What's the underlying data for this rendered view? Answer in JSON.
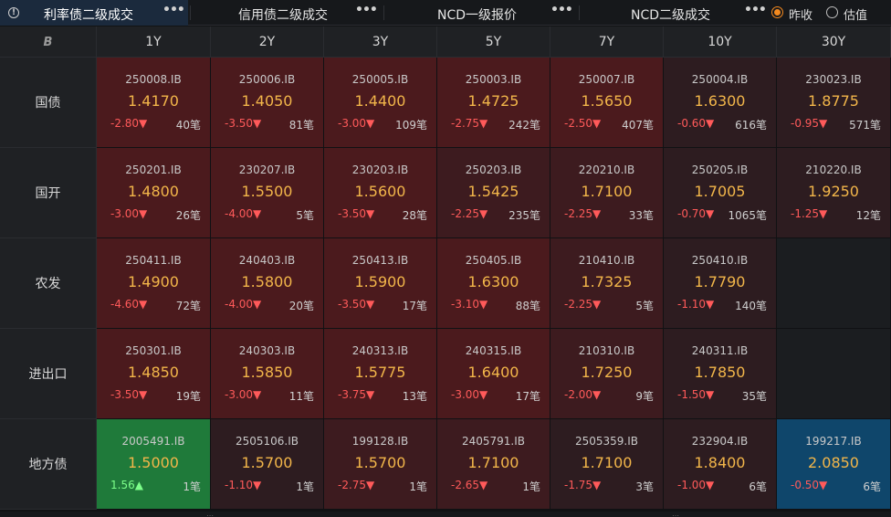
{
  "tabs": [
    {
      "label": "利率债二级成交",
      "active": true
    },
    {
      "label": "信用债二级成交",
      "active": false
    },
    {
      "label": "NCD一级报价",
      "active": false
    },
    {
      "label": "NCD二级成交",
      "active": false
    }
  ],
  "radios": [
    {
      "label": "昨收",
      "checked": true
    },
    {
      "label": "估值",
      "checked": false
    }
  ],
  "dots": "•••",
  "corner_icon": "B",
  "terms": [
    "1Y",
    "2Y",
    "3Y",
    "5Y",
    "7Y",
    "10Y",
    "30Y"
  ],
  "colors": {
    "bg_red_strong": "#4b1a1d",
    "bg_red_mid": "#3d1b1f",
    "bg_red_dim": "#2d1c20",
    "bg_green": "#1f7a3a",
    "bg_blue": "#0f466b",
    "price": "#f2b64a",
    "change_down": "#ff5a5a",
    "change_up": "#7dff8a"
  },
  "rows": [
    {
      "label": "国债",
      "cells": [
        {
          "code": "250008.IB",
          "price": "1.4170",
          "change": "-2.80▼",
          "count": "40笔",
          "tone": "red_strong"
        },
        {
          "code": "250006.IB",
          "price": "1.4050",
          "change": "-3.50▼",
          "count": "81笔",
          "tone": "red_strong"
        },
        {
          "code": "250005.IB",
          "price": "1.4400",
          "change": "-3.00▼",
          "count": "109笔",
          "tone": "red_strong"
        },
        {
          "code": "250003.IB",
          "price": "1.4725",
          "change": "-2.75▼",
          "count": "242笔",
          "tone": "red_strong"
        },
        {
          "code": "250007.IB",
          "price": "1.5650",
          "change": "-2.50▼",
          "count": "407笔",
          "tone": "red_strong"
        },
        {
          "code": "250004.IB",
          "price": "1.6300",
          "change": "-0.60▼",
          "count": "616笔",
          "tone": "red_dim"
        },
        {
          "code": "230023.IB",
          "price": "1.8775",
          "change": "-0.95▼",
          "count": "571笔",
          "tone": "red_dim"
        }
      ]
    },
    {
      "label": "国开",
      "cells": [
        {
          "code": "250201.IB",
          "price": "1.4800",
          "change": "-3.00▼",
          "count": "26笔",
          "tone": "red_strong"
        },
        {
          "code": "230207.IB",
          "price": "1.5500",
          "change": "-4.00▼",
          "count": "5笔",
          "tone": "red_strong"
        },
        {
          "code": "230203.IB",
          "price": "1.5600",
          "change": "-3.50▼",
          "count": "28笔",
          "tone": "red_strong"
        },
        {
          "code": "250203.IB",
          "price": "1.5425",
          "change": "-2.25▼",
          "count": "235笔",
          "tone": "red_mid"
        },
        {
          "code": "220210.IB",
          "price": "1.7100",
          "change": "-2.25▼",
          "count": "33笔",
          "tone": "red_mid"
        },
        {
          "code": "250205.IB",
          "price": "1.7005",
          "change": "-0.70▼",
          "count": "1065笔",
          "tone": "red_dim"
        },
        {
          "code": "210220.IB",
          "price": "1.9250",
          "change": "-1.25▼",
          "count": "12笔",
          "tone": "red_dim"
        }
      ]
    },
    {
      "label": "农发",
      "cells": [
        {
          "code": "250411.IB",
          "price": "1.4900",
          "change": "-4.60▼",
          "count": "72笔",
          "tone": "red_strong"
        },
        {
          "code": "240403.IB",
          "price": "1.5800",
          "change": "-4.00▼",
          "count": "20笔",
          "tone": "red_strong"
        },
        {
          "code": "250413.IB",
          "price": "1.5900",
          "change": "-3.50▼",
          "count": "17笔",
          "tone": "red_strong"
        },
        {
          "code": "250405.IB",
          "price": "1.6300",
          "change": "-3.10▼",
          "count": "88笔",
          "tone": "red_strong"
        },
        {
          "code": "210410.IB",
          "price": "1.7325",
          "change": "-2.25▼",
          "count": "5笔",
          "tone": "red_mid"
        },
        {
          "code": "250410.IB",
          "price": "1.7790",
          "change": "-1.10▼",
          "count": "140笔",
          "tone": "red_dim"
        },
        null
      ]
    },
    {
      "label": "进出口",
      "cells": [
        {
          "code": "250301.IB",
          "price": "1.4850",
          "change": "-3.50▼",
          "count": "19笔",
          "tone": "red_strong"
        },
        {
          "code": "240303.IB",
          "price": "1.5850",
          "change": "-3.00▼",
          "count": "11笔",
          "tone": "red_strong"
        },
        {
          "code": "240313.IB",
          "price": "1.5775",
          "change": "-3.75▼",
          "count": "13笔",
          "tone": "red_strong"
        },
        {
          "code": "240315.IB",
          "price": "1.6400",
          "change": "-3.00▼",
          "count": "17笔",
          "tone": "red_strong"
        },
        {
          "code": "210310.IB",
          "price": "1.7250",
          "change": "-2.00▼",
          "count": "9笔",
          "tone": "red_mid"
        },
        {
          "code": "240311.IB",
          "price": "1.7850",
          "change": "-1.50▼",
          "count": "35笔",
          "tone": "red_dim"
        },
        null
      ]
    },
    {
      "label": "地方债",
      "cells": [
        {
          "code": "2005491.IB",
          "price": "1.5000",
          "change": "1.56▲",
          "count": "1笔",
          "tone": "green",
          "up": true
        },
        {
          "code": "2505106.IB",
          "price": "1.5700",
          "change": "-1.10▼",
          "count": "1笔",
          "tone": "red_dim"
        },
        {
          "code": "199128.IB",
          "price": "1.5700",
          "change": "-2.75▼",
          "count": "1笔",
          "tone": "red_mid"
        },
        {
          "code": "2405791.IB",
          "price": "1.7100",
          "change": "-2.65▼",
          "count": "1笔",
          "tone": "red_mid"
        },
        {
          "code": "2505359.IB",
          "price": "1.7100",
          "change": "-1.75▼",
          "count": "3笔",
          "tone": "red_dim"
        },
        {
          "code": "232904.IB",
          "price": "1.8400",
          "change": "-1.00▼",
          "count": "6笔",
          "tone": "red_dim"
        },
        {
          "code": "199217.IB",
          "price": "2.0850",
          "change": "-0.50▼",
          "count": "6笔",
          "tone": "blue"
        }
      ]
    }
  ]
}
